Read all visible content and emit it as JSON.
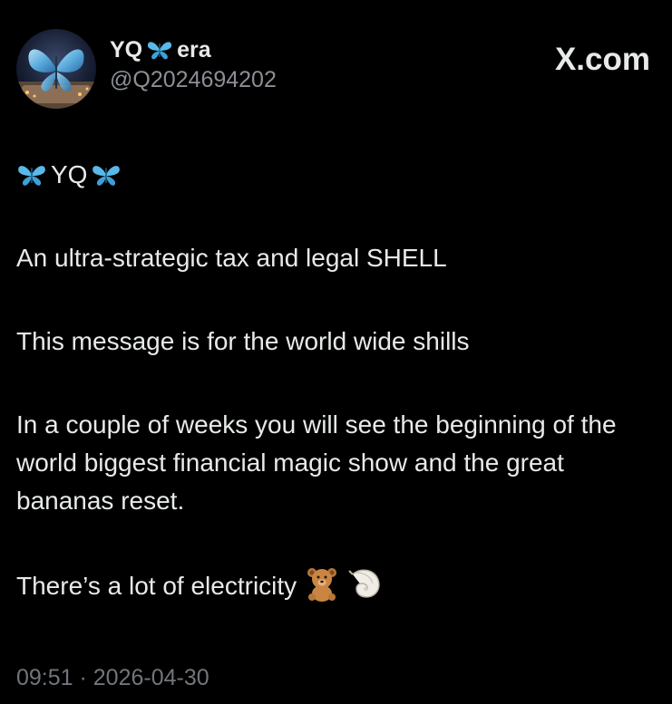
{
  "author": {
    "display_name_before": "YQ",
    "display_name_after": "era",
    "handle": "@Q2024694202",
    "avatar_icon": "butterfly-avatar-icon"
  },
  "brand": "X.com",
  "post": {
    "signature": "YQ",
    "line_1": "An ultra-strategic tax and legal SHELL",
    "line_2": "This message is for the world wide shills",
    "line_3": "In a couple of weeks you will see the beginning of the world biggest financial magic show and the great bananas reset.",
    "line_4": "There’s a lot of electricity",
    "emojis": [
      "teddy-bear-icon",
      "spiral-shell-icon"
    ]
  },
  "timestamp": "09:51 · 2026-04-30",
  "colors": {
    "background": "#000000",
    "text": "#e7e9ea",
    "secondary_text": "#71767b",
    "butterfly": "#5ab8e8"
  }
}
